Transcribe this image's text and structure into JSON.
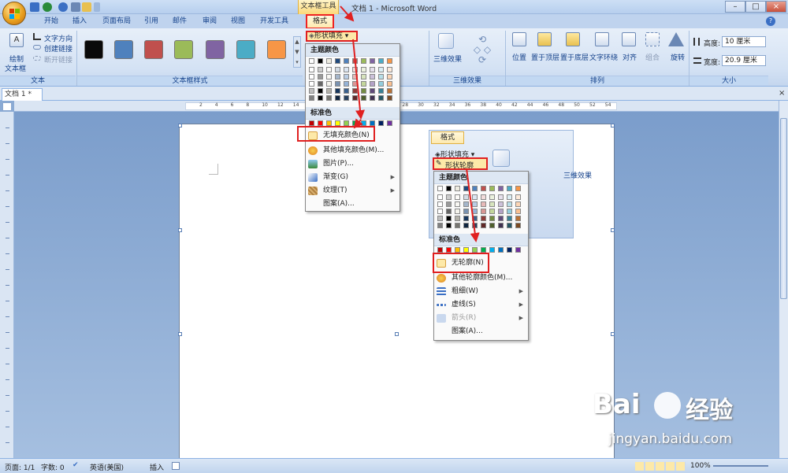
{
  "title_bar": {
    "context_tool": "文本框工具",
    "window_title": "文档 1 - Microsoft Word"
  },
  "ribbon_tabs": [
    "开始",
    "插入",
    "页面布局",
    "引用",
    "邮件",
    "审阅",
    "视图",
    "开发工具",
    "格式"
  ],
  "ribbon": {
    "text_group": {
      "draw_textbox": "绘制",
      "draw_textbox_2": "文本框",
      "text_direction": "文字方向",
      "create_link": "创建链接",
      "break_link": "断开链接",
      "label": "文本"
    },
    "textbox_styles": {
      "label": "文本框样式",
      "swatches": [
        "#0a0a0a",
        "#4f81bd",
        "#c0504d",
        "#9bbb59",
        "#8064a2",
        "#4bacc6",
        "#f79646"
      ],
      "shape_fill": "形状填充"
    },
    "effects_3d": {
      "label": "三维效果",
      "button": "三维效果"
    },
    "arrange": {
      "label": "排列",
      "items": [
        "位置",
        "置于顶层",
        "置于底层",
        "文字环绕",
        "对齐",
        "组合",
        "旋转"
      ]
    },
    "size": {
      "label": "大小",
      "height_label": "高度:",
      "height_value": "10 厘米",
      "width_label": "宽度:",
      "width_value": "20.9 厘米"
    }
  },
  "doc_tab": "文档 1 *",
  "ruler_numbers": [
    "2",
    "4",
    "6",
    "8",
    "10",
    "12",
    "14",
    "16",
    "18",
    "20",
    "22",
    "24",
    "26",
    "28",
    "30",
    "32",
    "34",
    "36",
    "38",
    "40",
    "42",
    "44",
    "46",
    "48",
    "50",
    "52",
    "54"
  ],
  "fill_menu": {
    "theme_header": "主题颜色",
    "std_header": "标准色",
    "items": [
      "无填充颜色(N)",
      "其他填充颜色(M)...",
      "图片(P)...",
      "渐变(G)",
      "纹理(T)",
      "图案(A)..."
    ]
  },
  "inset": {
    "tab": "格式",
    "shape_fill": "形状填充",
    "shape_outline": "形状轮廓",
    "threed": "三维效果",
    "theme_header": "主题颜色",
    "std_header": "标准色",
    "items": [
      "无轮廓(N)",
      "其他轮廓颜色(M)...",
      "粗细(W)",
      "虚线(S)",
      "箭头(R)",
      "图案(A)..."
    ]
  },
  "status": {
    "page": "页面: 1/1",
    "words": "字数: 0",
    "lang": "英语(美国)",
    "insert": "插入",
    "zoom": "100%"
  },
  "watermark": {
    "brand": "Bai",
    "suffix": "经验",
    "url": "jingyan.baidu.com"
  },
  "colors": {
    "theme_top": [
      "#ffffff",
      "#000000",
      "#eeece1",
      "#1f497d",
      "#4f81bd",
      "#c0504d",
      "#9bbb59",
      "#8064a2",
      "#4bacc6",
      "#f79646"
    ],
    "standard": [
      "#c00000",
      "#ff0000",
      "#ffc000",
      "#ffff00",
      "#92d050",
      "#00b050",
      "#00b0f0",
      "#0070c0",
      "#002060",
      "#7030a0"
    ]
  }
}
